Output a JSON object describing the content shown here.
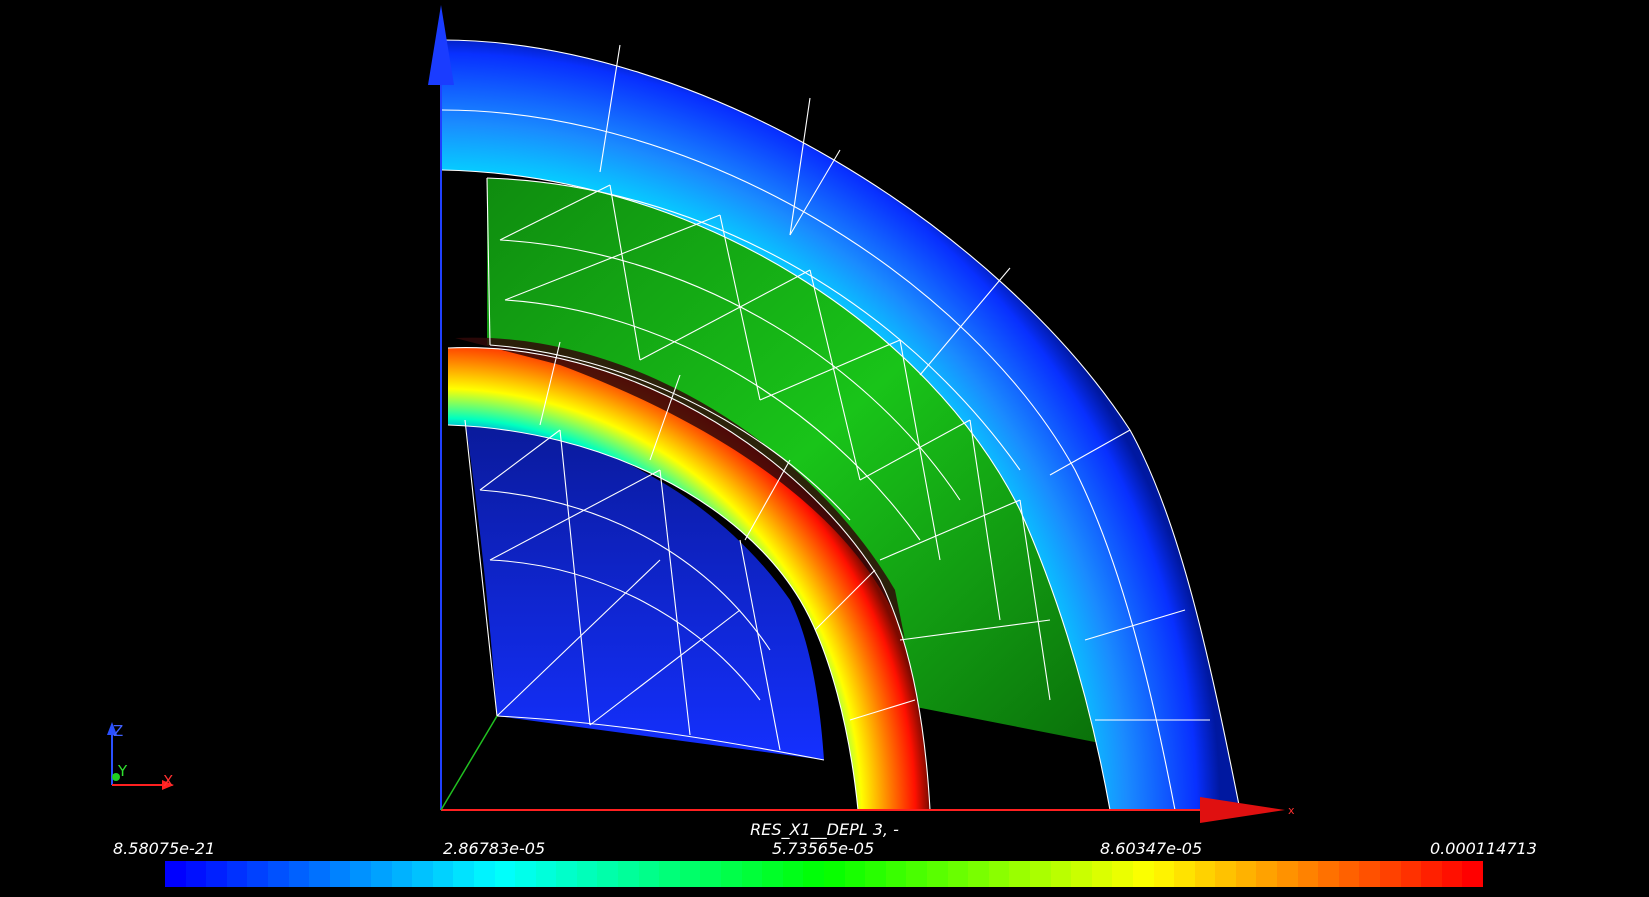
{
  "scalar_bar": {
    "title": "RES_X1__DEPL 3, -",
    "ticks": [
      "8.58075e-21",
      "2.86783e-05",
      "5.73565e-05",
      "8.60347e-05",
      "0.000114713"
    ],
    "colors": [
      "#0000ff",
      "#00ffff",
      "#00ff00",
      "#ffff00",
      "#ff0000"
    ]
  },
  "axes": {
    "main_x_label": "x",
    "orientation_z": "Z",
    "orientation_y": "Y",
    "orientation_x": "X"
  },
  "colors": {
    "background": "#000000",
    "mesh_edges": "#ffffff",
    "axis_x": "#ff2020",
    "axis_y": "#20c020",
    "axis_z": "#2040ff",
    "inner_block": "#0a28d8",
    "middle_block": "#14b814",
    "outer_ring": "#1e8cff",
    "inner_ring_hot": "#ff2a00"
  }
}
